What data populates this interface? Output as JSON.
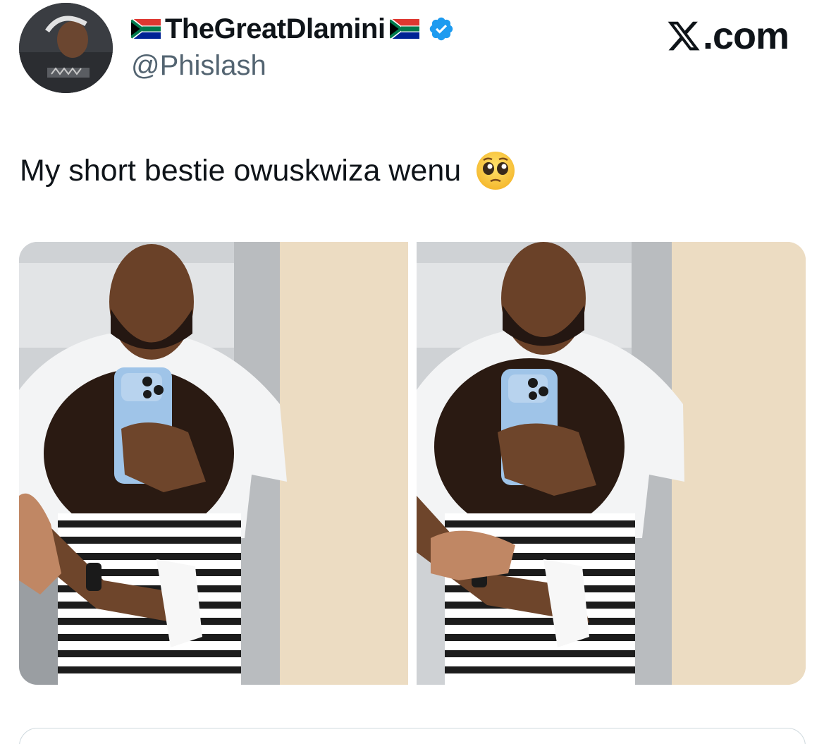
{
  "author": {
    "display_name": "TheGreatDlamini",
    "flag_icon": "south-africa-flag-icon",
    "verified_icon": "verified-badge-icon",
    "handle": "@Phislash"
  },
  "brand": {
    "icon": "x-logo-icon",
    "text": ".com"
  },
  "tweet": {
    "text": "My short bestie owuskwiza wenu",
    "emoji": "pleading-face-emoji"
  },
  "media": {
    "count": 2
  },
  "colors": {
    "verified": "#1d9bf0",
    "text_primary": "#0f1419",
    "text_secondary": "#536471",
    "border": "#cfd9de"
  }
}
